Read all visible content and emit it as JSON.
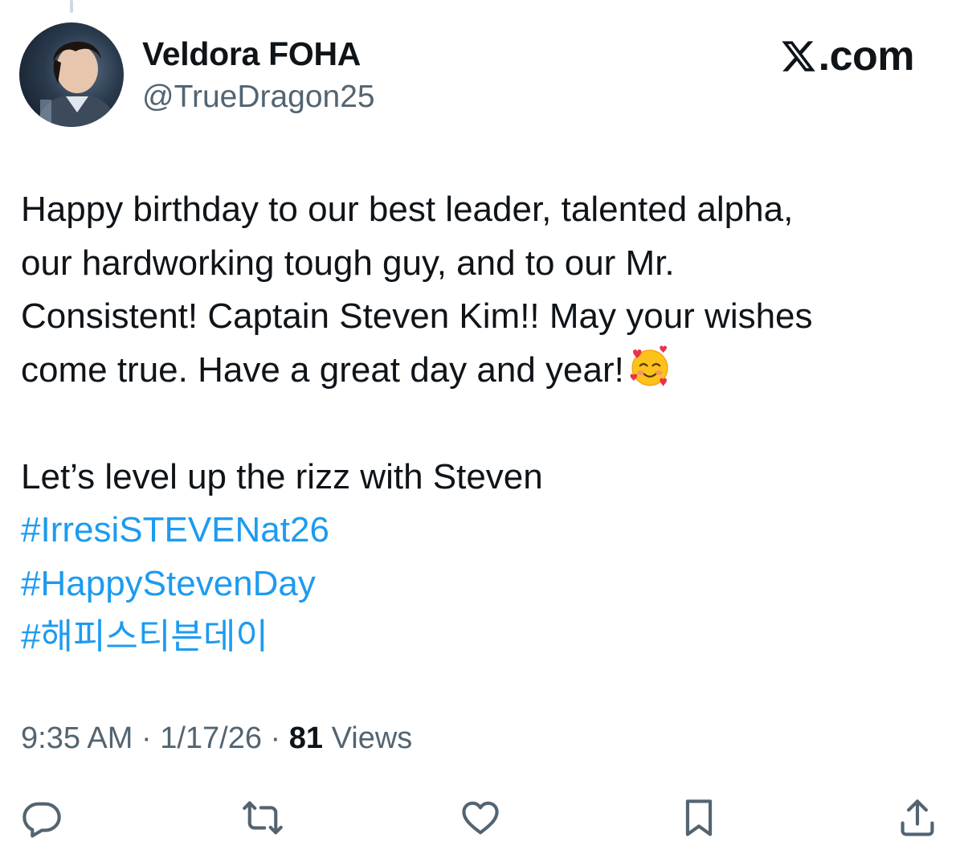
{
  "author": {
    "display_name": "Veldora FOHA",
    "handle": "@TrueDragon25"
  },
  "brand": {
    "label": ".com",
    "logo_icon": "x-logo-icon"
  },
  "tweet": {
    "lines": [
      "Happy birthday to our best leader, talented alpha,",
      "our hardworking tough guy, and to our Mr.",
      "Consistent! Captain Steven Kim!! May your wishes",
      "come true. Have a great day and year!"
    ],
    "emoji": "smiling-face-with-hearts",
    "second_paragraph": "Let’s level up the rizz with Steven",
    "hashtags": [
      "#IrresiSTEVENat26",
      "#HappyStevenDay",
      "#해피스티븐데이"
    ]
  },
  "meta": {
    "time": "9:35 AM",
    "date": "1/17/26",
    "separator": " · ",
    "views_count": "81",
    "views_label": "Views"
  },
  "actions": [
    {
      "name": "reply",
      "icon": "reply-icon"
    },
    {
      "name": "repost",
      "icon": "repost-icon"
    },
    {
      "name": "like",
      "icon": "heart-icon"
    },
    {
      "name": "bookmark",
      "icon": "bookmark-icon"
    },
    {
      "name": "share",
      "icon": "share-icon"
    }
  ],
  "colors": {
    "text": "#0f1419",
    "secondary": "#536471",
    "link": "#1d9bf0",
    "thread_line": "#cfd9de"
  }
}
